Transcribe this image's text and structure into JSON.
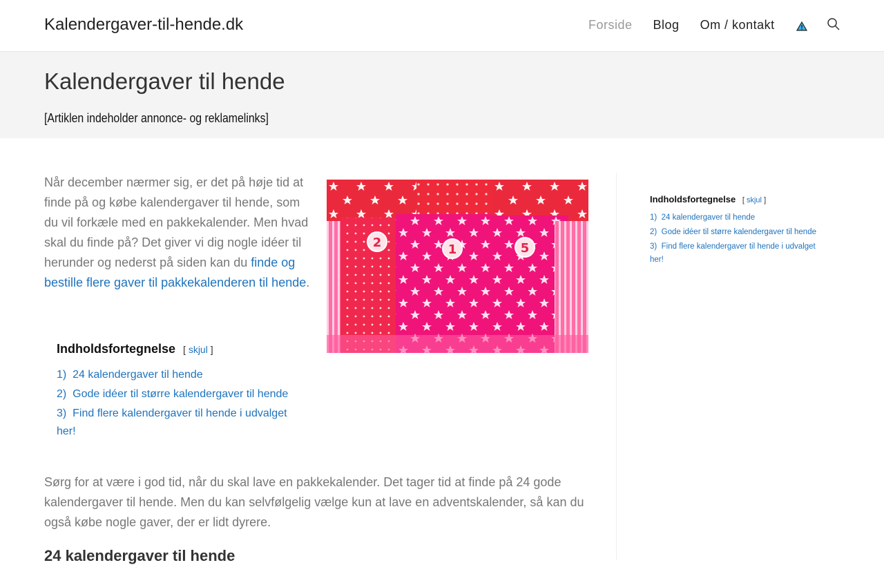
{
  "header": {
    "site_title": "Kalendergaver-til-hende.dk",
    "nav": [
      {
        "label": "Forside"
      },
      {
        "label": "Blog"
      },
      {
        "label": "Om / kontakt"
      }
    ]
  },
  "page": {
    "title": "Kalendergaver til hende",
    "disclaimer": "[Artiklen indeholder annonce- og reklamelinks]"
  },
  "article": {
    "intro_text": "Når december nærmer sig, er det på høje tid at finde på og købe kalendergaver til hende, som du vil forkæle med en pakkekalender. Men hvad skal du finde på? Det giver vi dig nogle idéer til herunder og nederst på siden kan du ",
    "intro_link": "finde og bestille flere gaver til pakkekalenderen til hende",
    "intro_end": ".",
    "body_text": "Sørg for at være i god tid, når du skal lave en pakkekalender. Det tager tid at finde på 24 gode kalendergaver til hende. Men du kan selvfølgelig vælge kun at lave en adventskalender, så kan du også købe nogle gaver, der er lidt dyrere.",
    "next_heading": "24 kalendergaver til hende"
  },
  "hero_image": {
    "bag_numbers": [
      "2",
      "1",
      "5"
    ]
  },
  "toc": {
    "title": "Indholdsfortegnelse",
    "toggle_open": "[",
    "toggle_label": "skjul",
    "toggle_close": "]",
    "items": [
      {
        "num": "1)",
        "label": "24 kalendergaver til hende"
      },
      {
        "num": "2)",
        "label": "Gode idéer til større kalendergaver til hende"
      },
      {
        "num": "3)",
        "label": "Find flere kalendergaver til hende i udvalget her!"
      }
    ]
  },
  "colors": {
    "link": "#1e73be",
    "nav_active": "#999999",
    "titlebar_bg": "#f4f4f4",
    "text_muted": "#777777"
  }
}
